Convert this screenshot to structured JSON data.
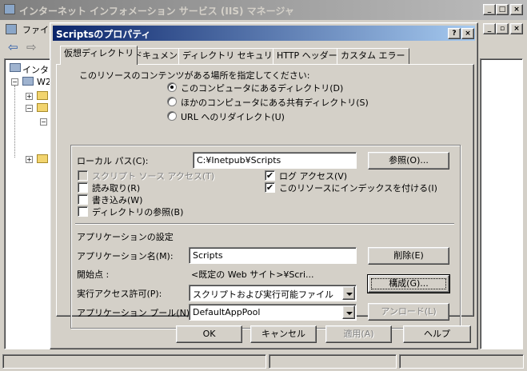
{
  "main_window": {
    "title": "インターネット インフォメーション サービス (IIS) マネージャ",
    "menu_partial": "ファイル",
    "tree_partial": [
      "インター",
      "W2"
    ],
    "colors": {
      "inactive_title": "#7f7f7f",
      "face": "#d4d0c8"
    }
  },
  "dialog": {
    "title": "Scriptsのプロパティ",
    "help_btn": "?",
    "close_btn": "×",
    "colors": {
      "title_start": "#0a246a",
      "title_end": "#a6caf0"
    },
    "tabs": [
      {
        "label": "仮想ディレクトリ",
        "active": true
      },
      {
        "label": "ドキュメント",
        "active": false
      },
      {
        "label": "ディレクトリ セキュリティ",
        "active": false
      },
      {
        "label": "HTTP ヘッダー",
        "active": false
      },
      {
        "label": "カスタム エラー",
        "active": false
      }
    ],
    "content_source_label": "このリソースのコンテンツがある場所を指定してください:",
    "radios": [
      {
        "label": "このコンピュータにあるディレクトリ(D)",
        "selected": true
      },
      {
        "label": "ほかのコンピュータにある共有ディレクトリ(S)",
        "selected": false
      },
      {
        "label": "URL へのリダイレクト(U)",
        "selected": false
      }
    ],
    "local_path": {
      "label": "ローカル パス(C):",
      "value": "C:¥Inetpub¥Scripts",
      "browse": "参照(O)..."
    },
    "checks_left": [
      {
        "label": "スクリプト ソース アクセス(T)",
        "checked": false,
        "disabled": true
      },
      {
        "label": "読み取り(R)",
        "checked": false,
        "disabled": false
      },
      {
        "label": "書き込み(W)",
        "checked": false,
        "disabled": false
      },
      {
        "label": "ディレクトリの参照(B)",
        "checked": false,
        "disabled": false
      }
    ],
    "checks_right": [
      {
        "label": "ログ アクセス(V)",
        "checked": true,
        "mark": "✔"
      },
      {
        "label": "このリソースにインデックスを付ける(I)",
        "checked": true,
        "mark": "✔"
      }
    ],
    "app_settings": {
      "heading": "アプリケーションの設定",
      "name_label": "アプリケーション名(M):",
      "name_value": "Scripts",
      "remove_btn": "削除(E)",
      "start_label": "開始点 :",
      "start_value": "<既定の Web サイト>¥Scri...",
      "config_btn": "構成(G)...",
      "exec_label": "実行アクセス許可(P):",
      "exec_value": "スクリプトおよび実行可能ファイル",
      "pool_label": "アプリケーション プール(N):",
      "pool_value": "DefaultAppPool",
      "unload_btn": "アンロード(L)"
    },
    "buttons": {
      "ok": "OK",
      "cancel": "キャンセル",
      "apply": "適用(A)",
      "help": "ヘルプ"
    }
  }
}
